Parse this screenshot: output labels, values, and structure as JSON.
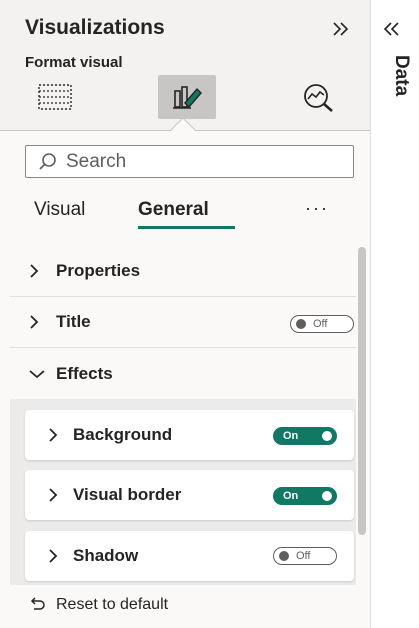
{
  "visualizations": {
    "title": "Visualizations",
    "collapse_icon": "double-chevron-right-icon",
    "subtitle": "Format visual",
    "format_tabs": [
      {
        "name": "build-visual-icon",
        "selected": false
      },
      {
        "name": "format-visual-icon",
        "selected": true
      },
      {
        "name": "analytics-icon",
        "selected": false
      }
    ],
    "search": {
      "placeholder": "Search",
      "value": ""
    },
    "subtabs": {
      "visual": "Visual",
      "general": "General",
      "active": "General",
      "more": "···"
    },
    "sections": {
      "properties": "Properties",
      "title": "Title",
      "title_toggle": "Off",
      "effects": "Effects"
    },
    "effects_items": {
      "background": "Background",
      "background_toggle": "On",
      "visual_border": "Visual border",
      "visual_border_toggle": "On",
      "shadow": "Shadow",
      "shadow_toggle": "Off"
    },
    "reset_label": "Reset to default",
    "accent_color": "#117865"
  },
  "data_pane": {
    "expand_icon": "double-chevron-left-icon",
    "label": "Data"
  }
}
